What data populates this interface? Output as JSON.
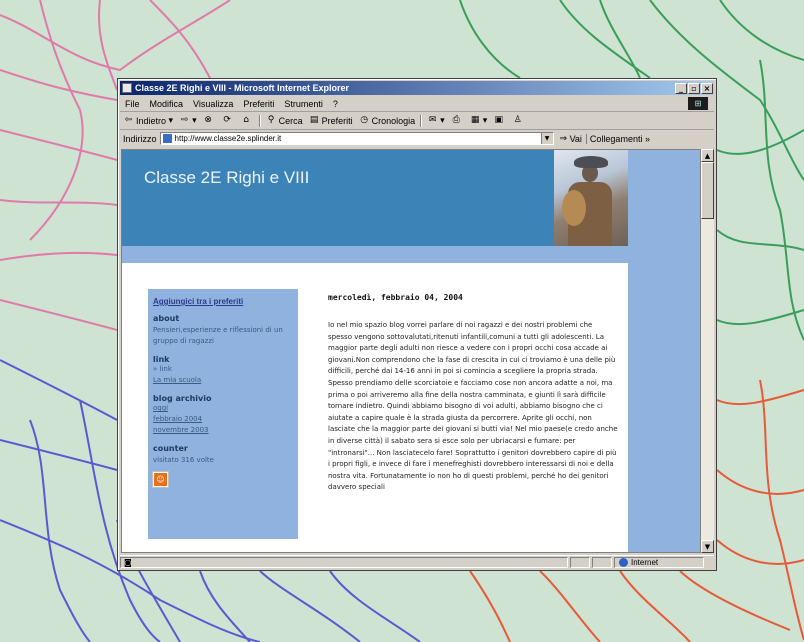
{
  "window": {
    "title": "Classe 2E Righi e VIII - Microsoft Internet Explorer",
    "controls": [
      "_",
      "\b",
      "x"
    ]
  },
  "menu": [
    "File",
    "Modifica",
    "Visualizza",
    "Preferiti",
    "Strumenti",
    "?"
  ],
  "toolbar": {
    "back": "Indietro",
    "search": "Cerca",
    "favorites": "Preferiti",
    "history": "Cronologia"
  },
  "address": {
    "label": "Indirizzo",
    "url": "http://www.classe2e.splinder.it",
    "go": "Vai",
    "links": "Collegamenti"
  },
  "blog": {
    "title": "Classe 2E Righi e VIII"
  },
  "sidebar": {
    "favorite_link": "Aggiungici tra i preferiti",
    "about_heading": "about",
    "about_text": "Pensieri,esperienze e riflessioni di un gruppo di ragazzi",
    "link_heading": "link",
    "links": [
      "» link",
      "La mia scuola"
    ],
    "archive_heading": "blog archivio",
    "archive": [
      "oggi",
      "febbraio 2004",
      "novembre 2003"
    ],
    "counter_heading": "counter",
    "counter_text": "visitato 316 volte"
  },
  "post": {
    "date": "mercoledì, febbraio 04, 2004",
    "body": "Io nel mio spazio blog vorrei parlare di noi ragazzi e dei nostri problemi che spesso vengono sottovalutati,ritenuti infantili,comuni a tutti gli adolescenti. La maggior parte degli adulti non riesce a vedere con i propri occhi cosa accade ai giovani.Non comprendono che la fase di crescita in cui ci troviamo è una delle più difficili, perché dai 14-16 anni in poi si comincia a scegliere la propria strada. Spesso prendiamo delle scorciatoie e facciamo cose non ancora adatte a noi, ma prima o poi arriveremo alla fine della nostra camminata, e giunti lì sarà difficile tornare indietro. Quindi abbiamo bisogno di voi adulti, abbiamo bisogno che ci aiutate a capire quale è la strada giusta da percorrere. Aprite gli occhi, non lasciate che la maggior parte dei giovani si butti via! Nel mio paese(e credo anche in diverse città) il sabato sera si esce solo per ubriacarsi e fumare: per \"intronarsi\"... Non lasciatecelo fare! Soprattutto i genitori dovrebbero capire di più i propri figli, e invece di fare i menefreghisti dovrebbero interessarsi di noi e della nostra vita. Fortunatamente io non ho di questi problemi, perché ho dei genitori davvero speciali"
  },
  "status": {
    "zone": "Internet"
  },
  "colors": {
    "desktop": "#cfe3d2",
    "header": "#3c84b8",
    "sidebar": "#8fb2de"
  }
}
